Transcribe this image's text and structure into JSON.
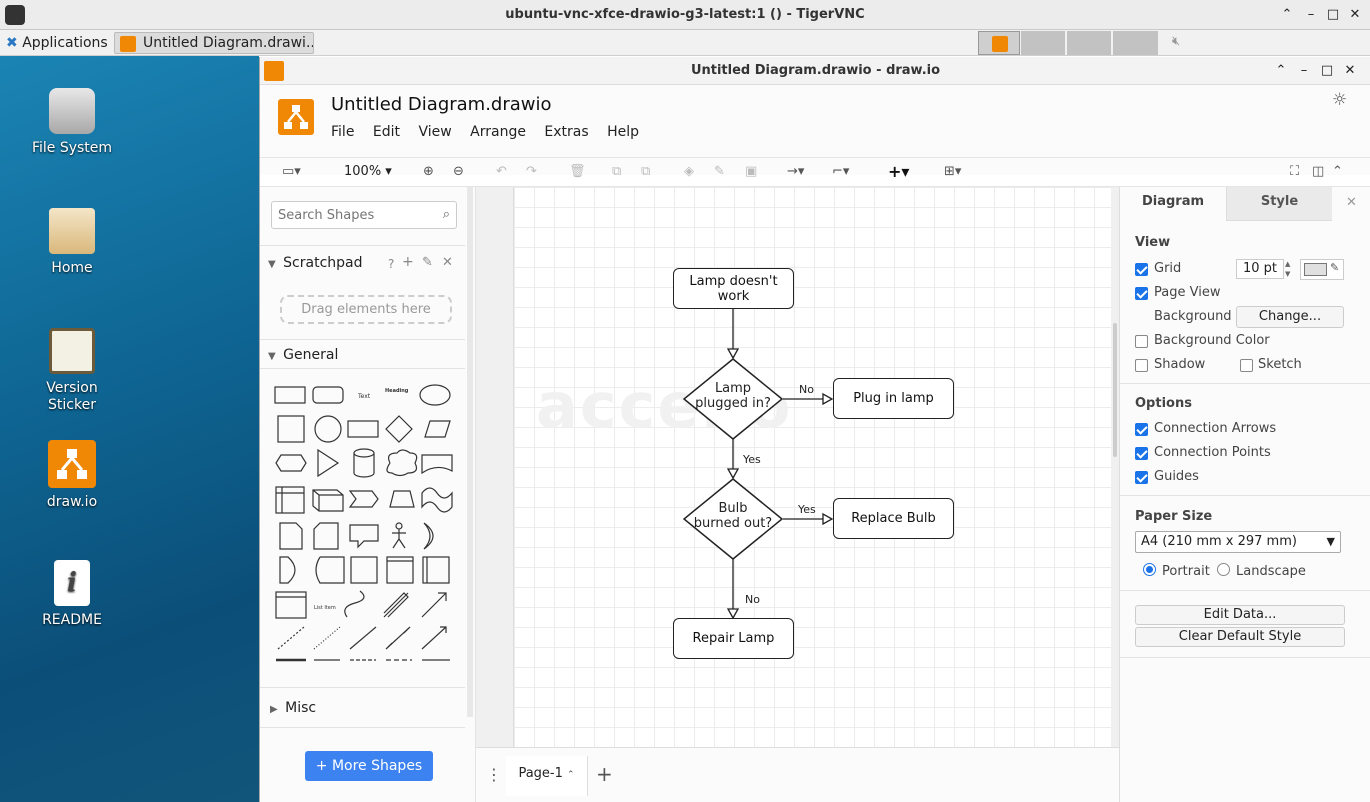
{
  "vnc": {
    "title": "ubuntu-vnc-xfce-drawio-g3-latest:1 () - TigerVNC"
  },
  "panel": {
    "applications": "Applications",
    "task_label": "Untitled Diagram.drawi..."
  },
  "desktop": {
    "icons": [
      {
        "label": "File System"
      },
      {
        "label": "Home"
      },
      {
        "label": "Version\nSticker"
      },
      {
        "label": "draw.io"
      },
      {
        "label": "README"
      }
    ]
  },
  "app": {
    "window_title": "Untitled Diagram.drawio - draw.io",
    "doc_title": "Untitled Diagram.drawio",
    "menu": [
      "File",
      "Edit",
      "View",
      "Arrange",
      "Extras",
      "Help"
    ],
    "zoom": "100%"
  },
  "left": {
    "search_placeholder": "Search Shapes",
    "scratchpad": "Scratchpad",
    "scratchpad_help": "?",
    "drag_here": "Drag elements here",
    "general": "General",
    "misc": "Misc",
    "more_shapes": "More Shapes",
    "shape_text": "Text",
    "shape_heading": "Heading",
    "shape_listitem": "List Item"
  },
  "canvas": {
    "watermark": "accelio",
    "nodes": {
      "start": "Lamp doesn't work",
      "q1": "Lamp\nplugged in?",
      "a1": "Plug in lamp",
      "q2": "Bulb\nburned out?",
      "a2": "Replace Bulb",
      "end": "Repair Lamp"
    },
    "edges": {
      "no1": "No",
      "yes1": "Yes",
      "yes2": "Yes",
      "no2": "No"
    }
  },
  "pages": {
    "current": "Page-1"
  },
  "right": {
    "tab_diagram": "Diagram",
    "tab_style": "Style",
    "view": "View",
    "grid": "Grid",
    "grid_size": "10 pt",
    "page_view": "Page View",
    "background": "Background",
    "change": "Change...",
    "background_color": "Background Color",
    "shadow": "Shadow",
    "sketch": "Sketch",
    "options": "Options",
    "connection_arrows": "Connection Arrows",
    "connection_points": "Connection Points",
    "guides": "Guides",
    "paper_size": "Paper Size",
    "paper_value": "A4 (210 mm x 297 mm)",
    "portrait": "Portrait",
    "landscape": "Landscape",
    "edit_data": "Edit Data...",
    "clear_style": "Clear Default Style"
  },
  "colors": {
    "accent": "#f08705",
    "blue": "#1a73e8"
  }
}
